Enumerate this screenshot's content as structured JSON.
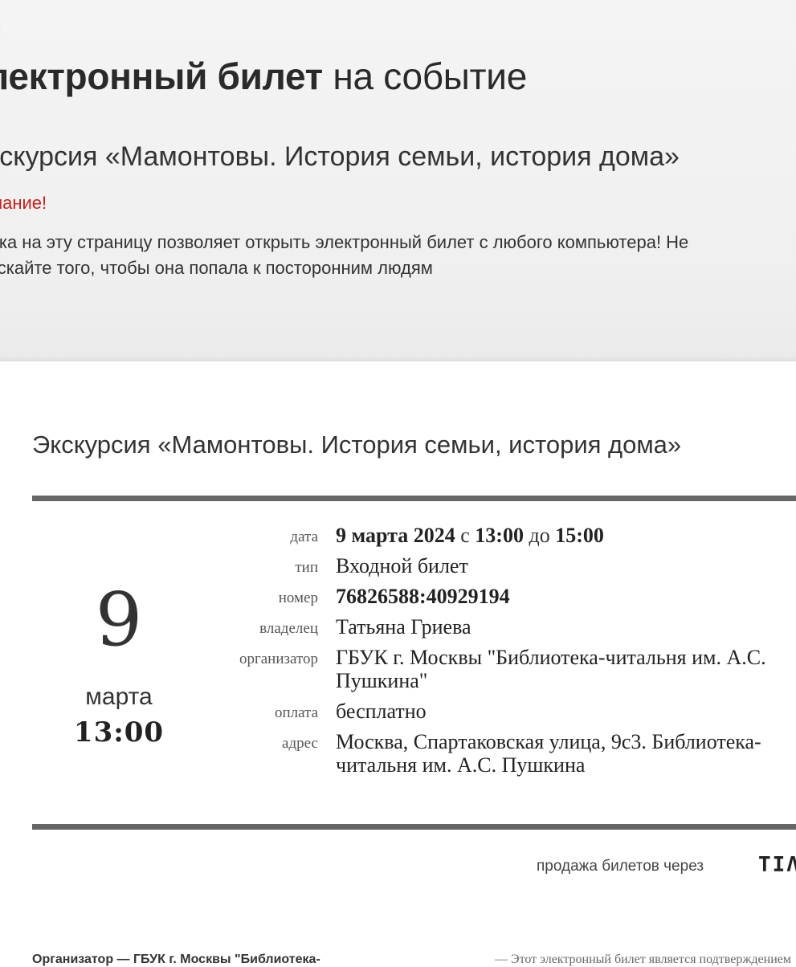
{
  "hero": {
    "title_bold": "лектронный билет",
    "title_rest": "на событие",
    "event_name": "кскурсия «Мамонтовы. История семьи, история дома»",
    "warning": "мание!",
    "note_line1": "лка на эту страницу позволяет открыть электронный билет с любого компьютера! Не",
    "note_line2": "ускайте того, чтобы она попала к посторонним людям"
  },
  "ticket": {
    "event_name": "Экскурсия «Мамонтовы. История семьи, история дома»",
    "day": "9",
    "month": "марта",
    "time": "13:00",
    "labels": {
      "date": "дата",
      "type": "тип",
      "number": "номер",
      "owner": "владелец",
      "organizer": "организатор",
      "payment": "оплата",
      "address": "адрес"
    },
    "date_value": {
      "date": "9 марта 2024",
      "from_word": "с",
      "start": "13:00",
      "to_word": "до",
      "end": "15:00"
    },
    "type": "Входной билет",
    "number": "76826588:40929194",
    "owner": "Татьяна Гриева",
    "organizer_line1": "ГБУК г. Москвы \"Библиотека-читальня им. А.С.",
    "organizer_line2": "Пушкина\"",
    "payment": "бесплатно",
    "address_line1": "Москва, Спартаковская улица, 9с3. Библиотека-",
    "address_line2": "читальня им. А.С. Пушкина"
  },
  "sales": {
    "text": "продажа билетов через",
    "logo": "ΤΙΛ"
  },
  "footer": {
    "left": "Организатор — ГБУК г. Москвы \"Библиотека-",
    "right": "— Этот электронный билет является подтверждением"
  }
}
